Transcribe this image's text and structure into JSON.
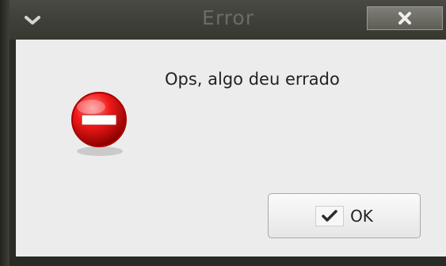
{
  "window": {
    "title": "Error"
  },
  "dialog": {
    "message": "Ops, algo deu errado",
    "ok_label": "OK",
    "icon": "error-stop-icon"
  },
  "colors": {
    "titlebar": "#3f3f39",
    "content_background": "#ececec",
    "error_red": "#e00000"
  }
}
